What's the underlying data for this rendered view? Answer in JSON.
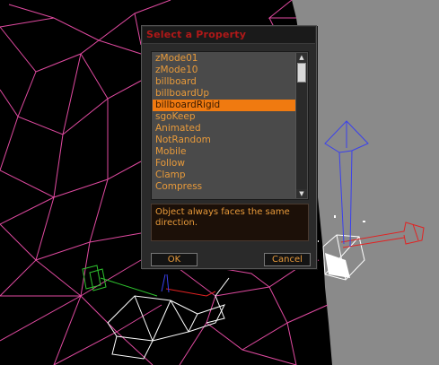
{
  "dialog": {
    "title": "Select a Property",
    "items": [
      "zMode01",
      "zMode10",
      "billboard",
      "billboardUp",
      "billboardRigid",
      "sgoKeep",
      "Animated",
      "NotRandom",
      "Mobile",
      "Follow",
      "Clamp",
      "Compress"
    ],
    "selected_index": 4,
    "description": "Object always faces the same direction.",
    "ok_label": "OK",
    "cancel_label": "Cancel"
  },
  "colors": {
    "title_red": "#b01818",
    "item_orange": "#e89a3a",
    "selection_orange": "#f07a10",
    "wireframe_pink": "#e04aa0",
    "viewport_gray": "#8a8a8a"
  }
}
